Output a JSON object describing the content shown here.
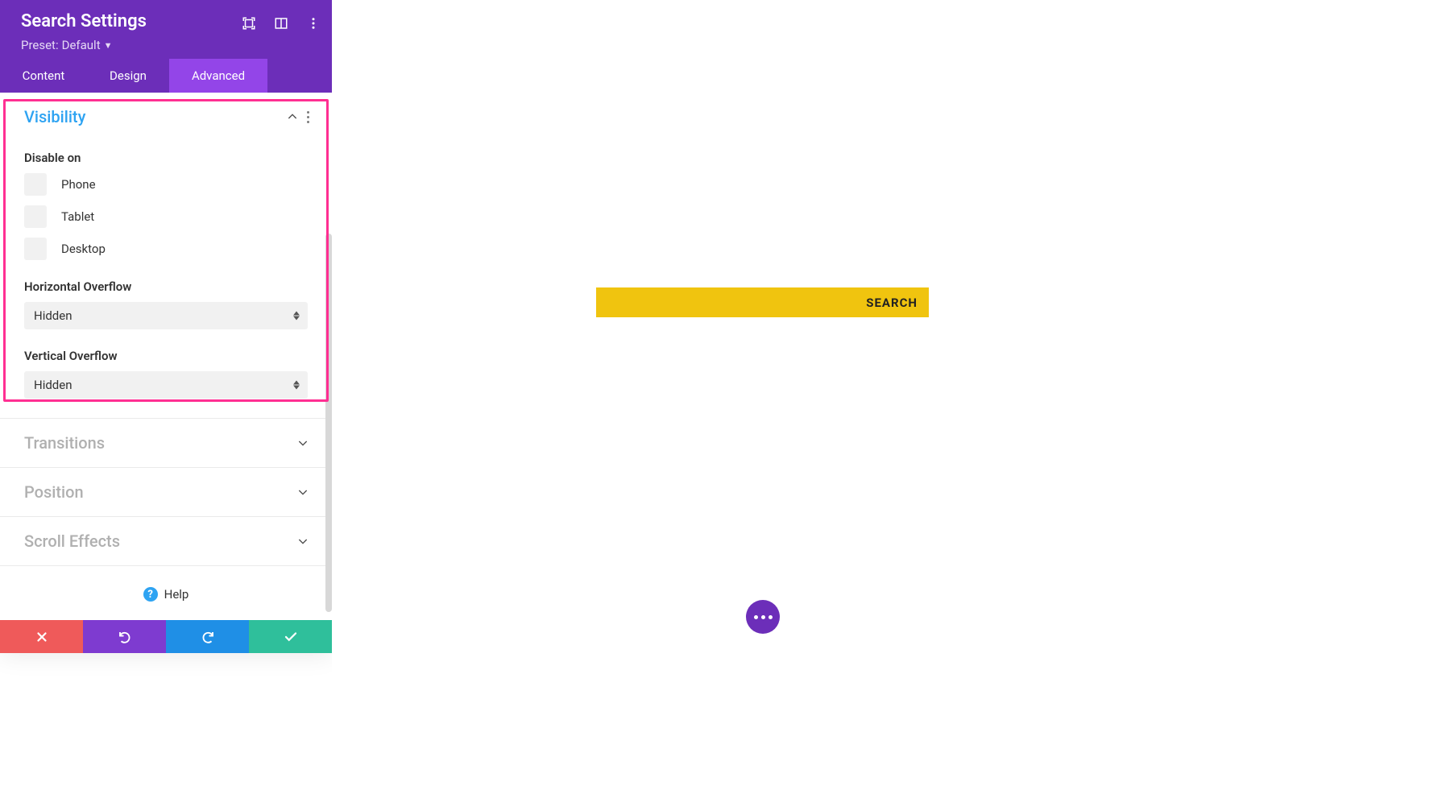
{
  "panel": {
    "title": "Search Settings",
    "preset_label": "Preset:",
    "preset_value": "Default"
  },
  "tabs": {
    "content": "Content",
    "design": "Design",
    "advanced": "Advanced"
  },
  "sections": {
    "visibility": {
      "title": "Visibility",
      "disable_on_label": "Disable on",
      "phone": "Phone",
      "tablet": "Tablet",
      "desktop": "Desktop",
      "horizontal_overflow_label": "Horizontal Overflow",
      "horizontal_overflow_value": "Hidden",
      "vertical_overflow_label": "Vertical Overflow",
      "vertical_overflow_value": "Hidden"
    },
    "transitions": {
      "title": "Transitions"
    },
    "position": {
      "title": "Position"
    },
    "scroll_effects": {
      "title": "Scroll Effects"
    }
  },
  "help": {
    "label": "Help"
  },
  "preview": {
    "search_button": "SEARCH"
  }
}
